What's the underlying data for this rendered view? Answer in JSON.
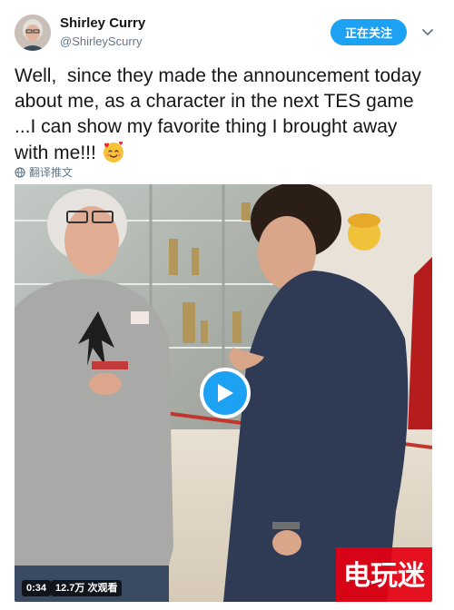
{
  "tweet": {
    "display_name": "Shirley Curry",
    "handle": "@ShirleyScurry",
    "follow_label": "正在关注",
    "text": "Well,  since they made the announcement today about me, as a character in the next TES game ...I can show my favorite thing I brought away with me!!! ",
    "emoji": "smiling-face-with-hearts",
    "translate_label": "翻译推文"
  },
  "video": {
    "duration": "0:34",
    "views": "12.7万 次观看",
    "play_icon": "play-icon"
  },
  "watermark": {
    "text": "电玩迷",
    "color": "#e60012"
  },
  "colors": {
    "accent": "#1da1f2",
    "text_primary": "#14171a",
    "text_secondary": "#657786"
  }
}
